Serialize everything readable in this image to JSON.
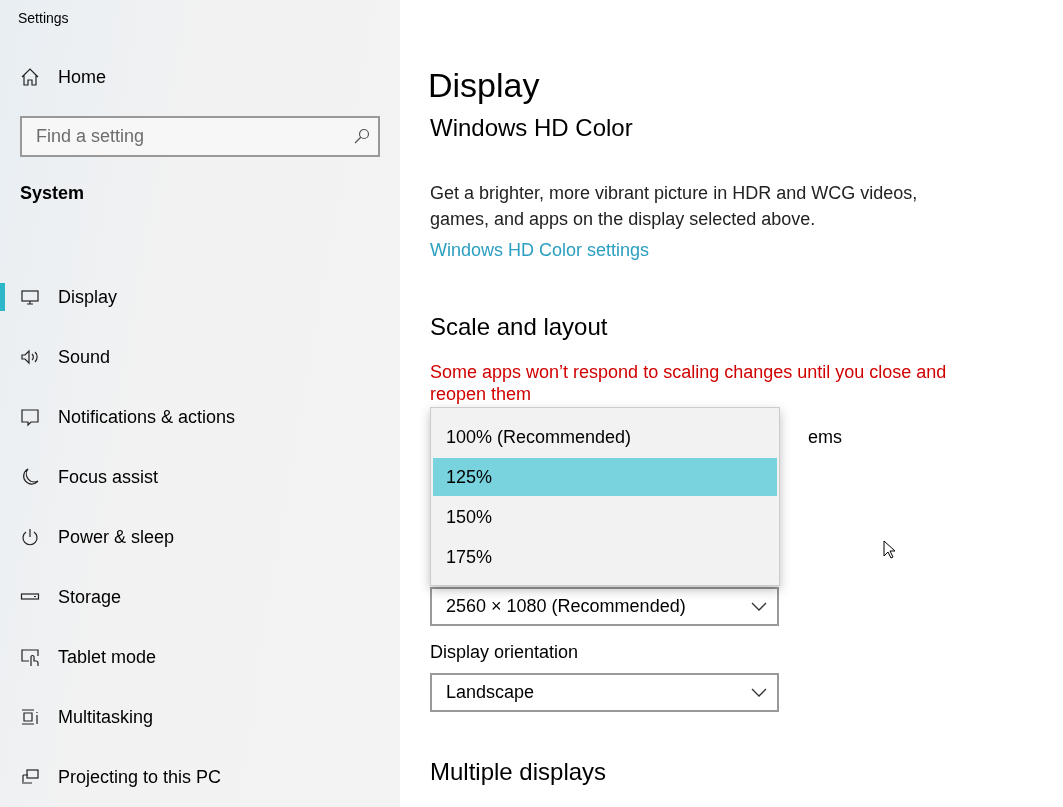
{
  "window": {
    "title": "Settings"
  },
  "sidebar": {
    "home": "Home",
    "search": {
      "placeholder": "Find a setting"
    },
    "section": "System",
    "items": [
      {
        "label": "Display",
        "selected": true
      },
      {
        "label": "Sound",
        "selected": false
      },
      {
        "label": "Notifications & actions",
        "selected": false
      },
      {
        "label": "Focus assist",
        "selected": false
      },
      {
        "label": "Power & sleep",
        "selected": false
      },
      {
        "label": "Storage",
        "selected": false
      },
      {
        "label": "Tablet mode",
        "selected": false
      },
      {
        "label": "Multitasking",
        "selected": false
      },
      {
        "label": "Projecting to this PC",
        "selected": false
      }
    ]
  },
  "main": {
    "title": "Display",
    "hd_color": {
      "heading": "Windows HD Color",
      "description": "Get a brighter, more vibrant picture in HDR and WCG videos, games, and apps on the display selected above.",
      "link": "Windows HD Color settings"
    },
    "scale": {
      "heading": "Scale and layout",
      "warning": "Some apps won’t respond to scaling changes until you close and reopen them",
      "label_fragment": "ems"
    },
    "resolution": {
      "value": "2560 × 1080 (Recommended)"
    },
    "orientation": {
      "label": "Display orientation",
      "value": "Landscape"
    },
    "next_heading": "Multiple displays",
    "scale_menu": {
      "options": [
        {
          "label": "100% (Recommended)",
          "selected": false
        },
        {
          "label": "125%",
          "selected": true
        },
        {
          "label": "150%",
          "selected": false
        },
        {
          "label": "175%",
          "selected": false
        }
      ]
    }
  }
}
